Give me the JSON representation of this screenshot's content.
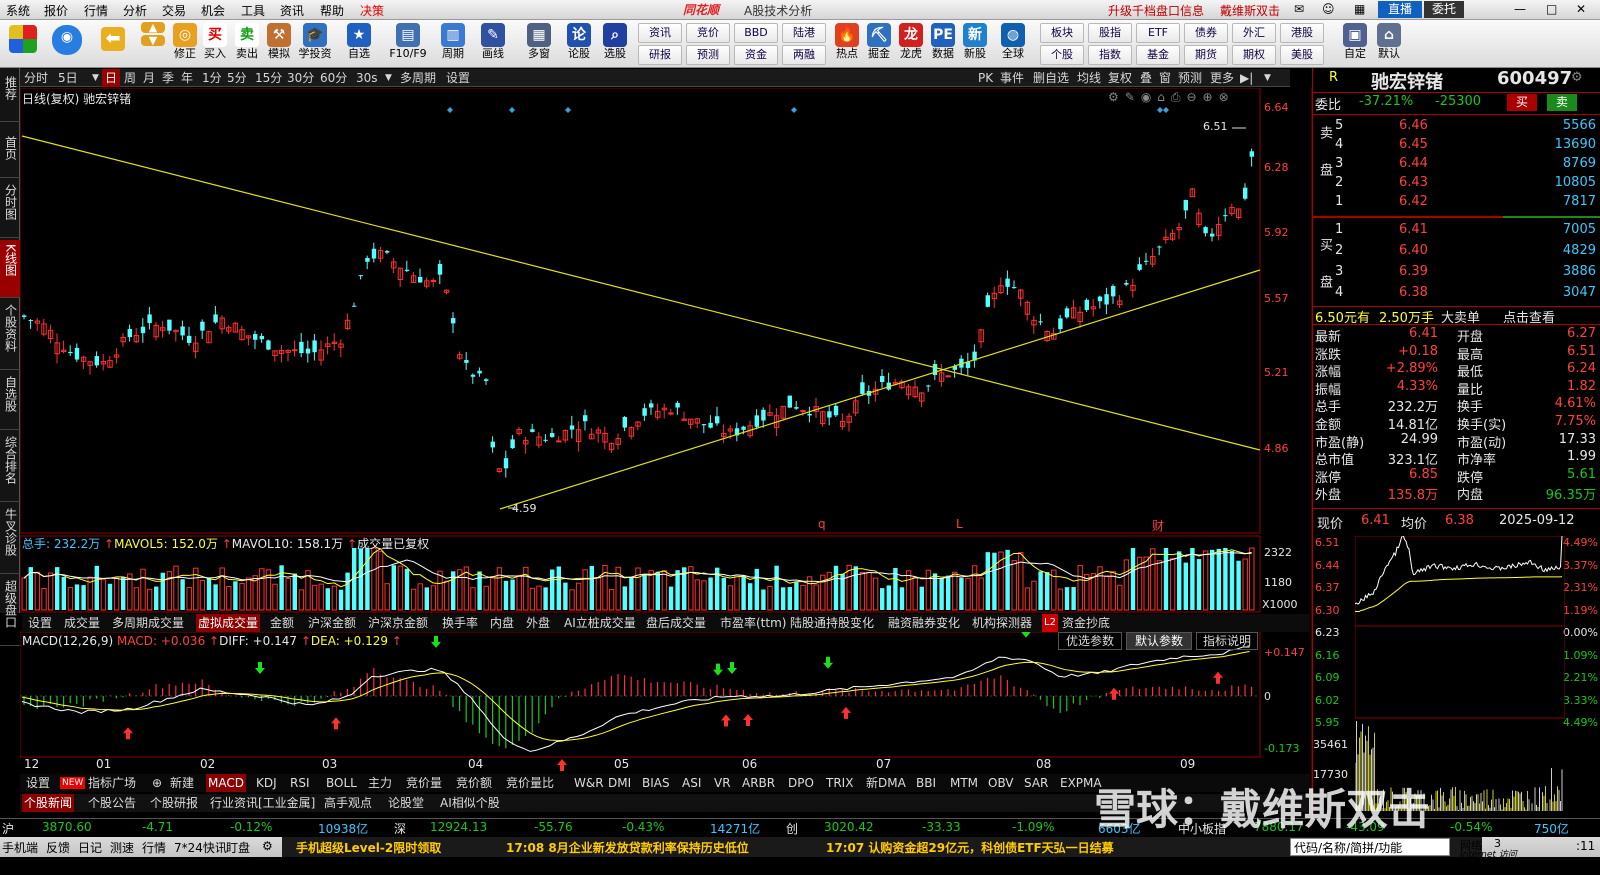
{
  "menu": [
    "系统",
    "报价",
    "行情",
    "分析",
    "交易",
    "机会",
    "工具",
    "资讯",
    "帮助",
    "决策"
  ],
  "app_logo": "同花顺",
  "window_title": "A股技术分析",
  "top_links": [
    "升级千档盘口信息",
    "戴维斯双击"
  ],
  "top_buttons": [
    "直播",
    "委托"
  ],
  "toolbar": {
    "left": [
      "修正",
      "买入",
      "卖出",
      "模拟",
      "学投资",
      "自选",
      "F10/F9",
      "周期",
      "画线",
      "多窗",
      "论股",
      "选股",
      "热点",
      "掘金",
      "龙虎",
      "数据",
      "新股",
      "全球",
      "自定",
      "默认"
    ],
    "grid": [
      [
        "资讯",
        "竞价",
        "BBD",
        "陆港"
      ],
      [
        "研报",
        "预测",
        "资金",
        "两融"
      ],
      [
        "板块",
        "股指",
        "ETF",
        "债券",
        "外汇",
        "港股"
      ],
      [
        "个股",
        "指数",
        "基金",
        "期货",
        "期权",
        "美股"
      ]
    ]
  },
  "left_tabs": [
    "推荐",
    "首页",
    "分时图",
    "K线图",
    "个股资料",
    "自选股",
    "综合排名",
    "牛叉诊股",
    "超级盘口"
  ],
  "period_tabs": [
    "分时",
    "5日",
    "日",
    "周",
    "月",
    "季",
    "年",
    "1分",
    "5分",
    "15分",
    "30分",
    "60分",
    "30s",
    "多周期",
    "设置"
  ],
  "period_right": [
    "PK",
    "事件",
    "删自选",
    "均线",
    "复权",
    "叠",
    "窗",
    "预测",
    "更多"
  ],
  "chart_title": "日线(复权)  驰宏锌锗",
  "main_chart": {
    "labels": [
      "6.64",
      "6.28",
      "5.92",
      "5.57",
      "5.21",
      "4.86"
    ],
    "high_label": "6.51",
    "low_label": "4.59",
    "events": [
      "q",
      "L",
      "财"
    ]
  },
  "volume": {
    "header": "总手: 232.2万",
    "mavol5": "MAVOL5: 152.0万",
    "mavol10": "MAVOL10: 158.1万",
    "note": "成交量已复权",
    "ticks": [
      "2322",
      "1180",
      "X1000"
    ]
  },
  "indicator_tabs": [
    "设置",
    "成交量",
    "多周期成交量",
    "虚拟成交量",
    "金额",
    "沪深金额",
    "沪深京金额",
    "换手率",
    "内盘",
    "外盘",
    "AI立桩成交量",
    "盘后成交量",
    "市盈率(ttm)",
    "陆股通持股变化",
    "融资融券变化",
    "机构探测器",
    "L2",
    "资金抄底"
  ],
  "macd": {
    "header": "MACD(12,26,9)",
    "macd": "MACD: +0.036",
    "diff": "DIFF: +0.147",
    "dea": "DEA: +0.129",
    "ticks": [
      "+0.147",
      "0",
      "-0.173"
    ],
    "buttons": [
      "优选参数",
      "默认参数",
      "指标说明"
    ]
  },
  "date_axis": [
    "12",
    "01",
    "02",
    "03",
    "04",
    "05",
    "06",
    "07",
    "08",
    "09"
  ],
  "bottom_tabs": [
    "设置",
    "NEW",
    "指标广场",
    "新建",
    "MACD",
    "KDJ",
    "RSI",
    "BOLL",
    "主力",
    "竞价量",
    "竞价额",
    "竞价量比",
    "W&R",
    "DMI",
    "BIAS",
    "ASI",
    "VR",
    "ARBR",
    "DPO",
    "TRIX",
    "新DMA",
    "BBI",
    "MTM",
    "OBV",
    "SAR",
    "EXPMA"
  ],
  "news_tabs": [
    "个股新闻",
    "个股公告",
    "个股研报",
    "行业资讯[工业金属]",
    "高手观点",
    "论股堂",
    "AI相似个股"
  ],
  "quote": {
    "flag": "R",
    "name": "驰宏锌锗",
    "code": "600497",
    "weibi_label": "委比",
    "weibi": "-37.21%",
    "weicha": "-25300",
    "buy": "买",
    "sell": "卖",
    "asks": [
      [
        "5",
        "6.46",
        "5566"
      ],
      [
        "4",
        "6.45",
        "13690"
      ],
      [
        "3",
        "6.44",
        "8769"
      ],
      [
        "2",
        "6.43",
        "10805"
      ],
      [
        "1",
        "6.42",
        "7817"
      ]
    ],
    "ask_side": "卖盘",
    "bid_side": "买盘",
    "bids": [
      [
        "1",
        "6.41",
        "7005"
      ],
      [
        "2",
        "6.40",
        "4829"
      ],
      [
        "3",
        "6.39",
        "3886"
      ],
      [
        "4",
        "6.38",
        "3047"
      ]
    ],
    "bigorder": [
      "6.50元有",
      "2.50万手",
      "大卖单",
      "点击查看"
    ],
    "stats": [
      [
        "最新",
        "6.41",
        "开盘",
        "6.27"
      ],
      [
        "涨跌",
        "+0.18",
        "最高",
        "6.51"
      ],
      [
        "涨幅",
        "+2.89%",
        "最低",
        "6.24"
      ],
      [
        "振幅",
        "4.33%",
        "量比",
        "1.82"
      ],
      [
        "总手",
        "232.2万",
        "换手",
        "4.61%"
      ],
      [
        "金额",
        "14.81亿",
        "换手(实)",
        "7.75%"
      ],
      [
        "市盈(静)",
        "24.99",
        "市盈(动)",
        "17.33"
      ],
      [
        "总市值",
        "323.1亿",
        "市净率",
        "1.99"
      ],
      [
        "涨停",
        "6.85",
        "跌停",
        "5.61"
      ],
      [
        "外盘",
        "135.8万",
        "内盘",
        "96.35万"
      ]
    ],
    "intraday": {
      "now_label": "现价",
      "now": "6.41",
      "avg_label": "均价",
      "avg": "6.38",
      "date": "2025-09-12",
      "left": [
        "6.51",
        "6.44",
        "6.37",
        "6.30",
        "6.23",
        "6.16",
        "6.09",
        "6.02",
        "5.95"
      ],
      "right": [
        "4.49%",
        "3.37%",
        "2.31%",
        "1.19%",
        "0.00%",
        "1.09%",
        "2.21%",
        "3.33%",
        "4.49%"
      ],
      "vol": [
        "35461",
        "17730"
      ]
    }
  },
  "index_bar": [
    [
      "沪",
      "3870.60",
      "-4.71",
      "-0.12%",
      "10938亿"
    ],
    [
      "深",
      "12924.13",
      "-55.76",
      "-0.43%",
      "14271亿"
    ],
    [
      "创",
      "3020.42",
      "-33.33",
      "-1.09%",
      "6603亿"
    ],
    [
      "中小板指",
      "7880.17",
      "-43.09",
      "-0.54%",
      "750亿"
    ]
  ],
  "bottom_bar": {
    "left": [
      "手机端",
      "反馈",
      "日记",
      "测速",
      "行情",
      "7*24快讯",
      "盯盘"
    ],
    "news": [
      "手机超级Level-2限时领取",
      "17:08 8月企业新发放贷款利率保持历史低位",
      "17:07 认购资金超29亿元，科创债ETF天弘一日结募"
    ],
    "right": [
      "代码/名称/简拼/功能",
      "网络",
      "3",
      "Internet 访问",
      ":11"
    ]
  },
  "watermark": "雪球：戴维斯双击"
}
